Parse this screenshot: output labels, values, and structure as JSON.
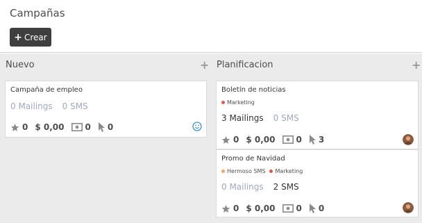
{
  "page": {
    "title": "Campañas",
    "create_label": "Crear"
  },
  "columns": [
    {
      "title": "Nuevo"
    },
    {
      "title": "Planificacion"
    }
  ],
  "cards": [
    {
      "title": "Campaña de empleo",
      "tags": [],
      "mailings": "0 Mailings",
      "sms": "0 SMS",
      "stats": {
        "rating": "0",
        "revenue": "$ 0,00",
        "quotations": "0",
        "clicks": "0"
      }
    },
    {
      "title": "Boletín de noticias",
      "tags": [
        {
          "label": "Marketing",
          "color": "#e05b4b"
        }
      ],
      "mailings": "3 Mailings",
      "sms": "0 SMS",
      "stats": {
        "rating": "0",
        "revenue": "$ 0,00",
        "quotations": "0",
        "clicks": "3"
      }
    },
    {
      "title": "Promo de Navidad",
      "tags": [
        {
          "label": "Hermoso SMS",
          "color": "#f4a261"
        },
        {
          "label": "Marketing",
          "color": "#e05b4b"
        }
      ],
      "mailings": "0 Mailings",
      "sms": "2 SMS",
      "stats": {
        "rating": "0",
        "revenue": "$ 0,00",
        "quotations": "0",
        "clicks": "0"
      }
    }
  ],
  "colors": {
    "accent": "#3f3f3f",
    "muted_count": "#a0a8c0",
    "activity": "#3a8fd8"
  }
}
